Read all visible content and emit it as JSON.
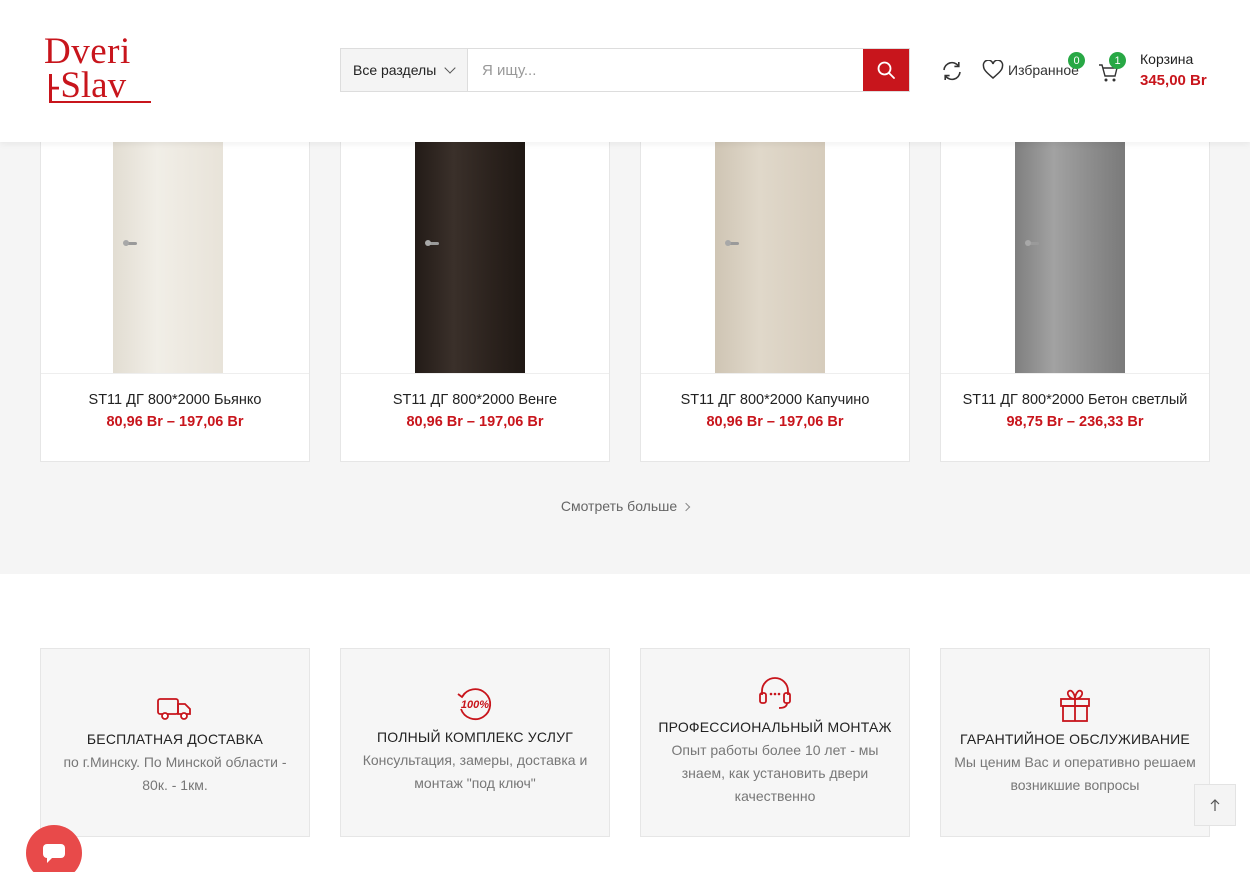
{
  "header": {
    "logo_line1": "Dveri",
    "logo_line2": "-Slav",
    "search": {
      "category_label": "Все разделы",
      "placeholder": "Я ищу..."
    },
    "wishlist": {
      "label": "Избранное",
      "count": "0"
    },
    "cart": {
      "label": "Корзина",
      "count": "1",
      "total": "345,00 Br"
    }
  },
  "products": [
    {
      "title": "ST11 ДГ 800*2000 Бьянко",
      "price": "80,96 Br – 197,06 Br",
      "door_color": "#ece8df"
    },
    {
      "title": "ST11 ДГ 800*2000 Венге",
      "price": "80,96 Br – 197,06 Br",
      "door_color": "#2a221e"
    },
    {
      "title": "ST11 ДГ 800*2000 Капучино",
      "price": "80,96 Br – 197,06 Br",
      "door_color": "#d9d0c1"
    },
    {
      "title": "ST11 ДГ 800*2000 Бетон светлый",
      "price": "98,75 Br – 236,33 Br",
      "door_color": "#8f8f8f"
    }
  ],
  "more_label": "Смотреть больше",
  "features": [
    {
      "icon": "truck-icon",
      "title": "БЕСПЛАТНАЯ ДОСТАВКА",
      "lines": [
        "по г.Минску. По Минской области -",
        "80к. - 1км."
      ]
    },
    {
      "icon": "100-percent-icon",
      "title": "ПОЛНЫЙ КОМПЛЕКС УСЛУГ",
      "lines": [
        "Консультация, замеры, доставка и",
        "монтаж \"под ключ\""
      ]
    },
    {
      "icon": "headset-icon",
      "title": "ПРОФЕССИОНАЛЬНЫЙ МОНТАЖ",
      "lines": [
        "Опыт работы более 10 лет - мы",
        "знаем, как установить двери",
        "качественно"
      ]
    },
    {
      "icon": "gift-icon",
      "title": "ГАРАНТИЙНОЕ ОБСЛУЖИВАНИЕ",
      "lines": [
        "Мы ценим Вас и оперативно решаем",
        "возникшие вопросы"
      ]
    }
  ],
  "colors": {
    "accent": "#c8151c",
    "badge": "#28a845",
    "chat": "#e84a4a"
  }
}
